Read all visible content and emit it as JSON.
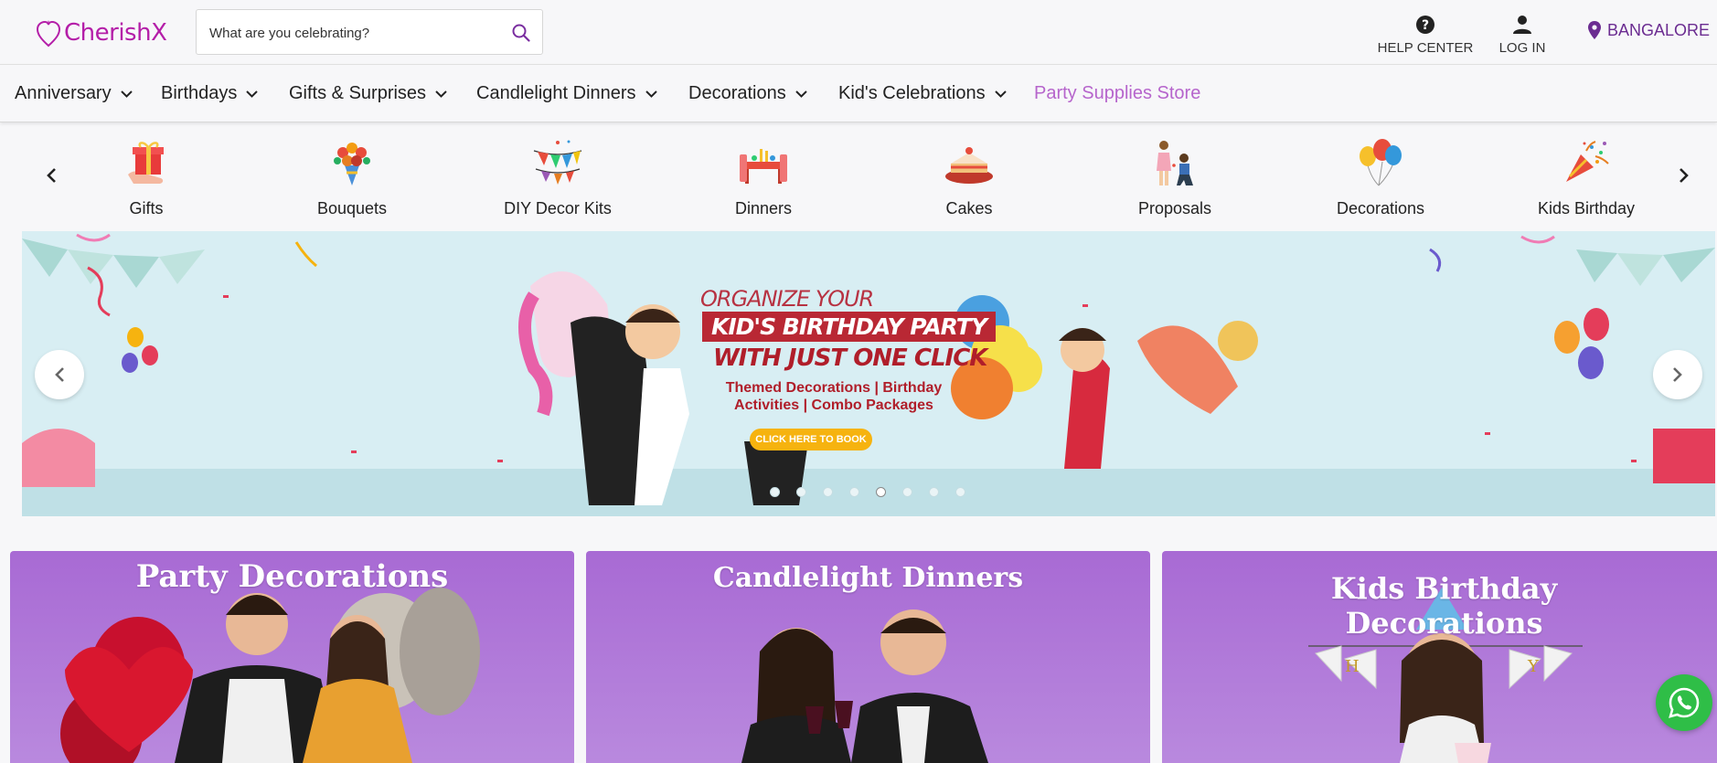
{
  "brand": {
    "name": "CherishX",
    "color": "#b41ea8"
  },
  "search": {
    "placeholder": "What are you celebrating?"
  },
  "header": {
    "help_label": "HELP CENTER",
    "login_label": "LOG IN",
    "city": "BANGALORE"
  },
  "nav": {
    "items": [
      {
        "label": "Anniversary"
      },
      {
        "label": "Birthdays"
      },
      {
        "label": "Gifts & Surprises"
      },
      {
        "label": "Candlelight Dinners"
      },
      {
        "label": "Decorations"
      },
      {
        "label": "Kid's Celebrations"
      }
    ],
    "special": "Party Supplies Store"
  },
  "categories": [
    {
      "label": "Gifts",
      "icon": "gift-icon"
    },
    {
      "label": "Bouquets",
      "icon": "bouquet-icon"
    },
    {
      "label": "DIY Decor Kits",
      "icon": "bunting-icon"
    },
    {
      "label": "Dinners",
      "icon": "dinner-table-icon"
    },
    {
      "label": "Cakes",
      "icon": "cake-icon"
    },
    {
      "label": "Proposals",
      "icon": "proposal-icon"
    },
    {
      "label": "Decorations",
      "icon": "balloons-icon"
    },
    {
      "label": "Kids Birthday",
      "icon": "party-popper-icon"
    }
  ],
  "banner": {
    "line1": "ORGANIZE YOUR",
    "line2": "KID'S BIRTHDAY PARTY",
    "line3": "WITH JUST ONE CLICK",
    "subtitle": "Themed Decorations | Birthday Activities | Combo Packages",
    "cta": "CLICK HERE TO BOOK",
    "slide_count": 8,
    "active_slide": 5
  },
  "cards": [
    {
      "title": "Party Decorations"
    },
    {
      "title": "Candlelight Dinners"
    },
    {
      "title_line1": "Kids Birthday",
      "title_line2": "Decorations"
    }
  ],
  "colors": {
    "accent": "#b665cc",
    "city": "#6b2c91",
    "card": "#a86ad4",
    "whatsapp": "#2fbe47"
  }
}
